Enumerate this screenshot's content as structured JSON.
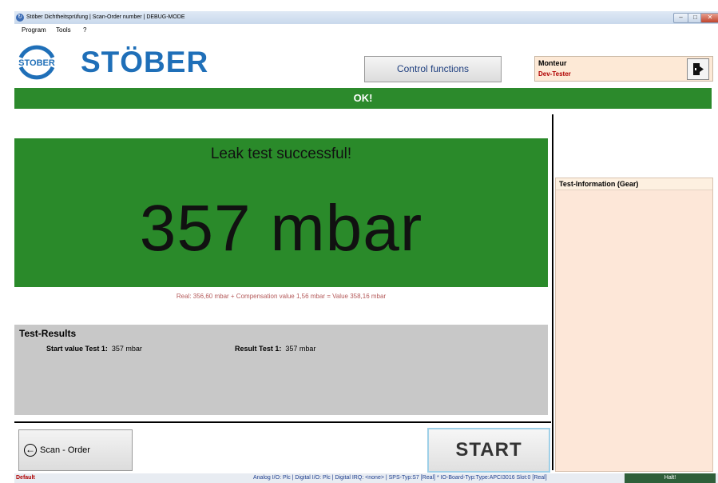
{
  "window": {
    "title": "Stöber Dichtheitsprüfung | Scan-Order number | DEBUG-MODE",
    "min_label": "–",
    "max_label": "□",
    "close_label": "✕"
  },
  "menu": {
    "items": [
      "Program",
      "Tools",
      "?"
    ]
  },
  "logo": {
    "text": "STÖBER",
    "badge_text": "STOBER"
  },
  "header": {
    "control_functions_label": "Control functions",
    "monteur_label": "Monteur",
    "monteur_value": "Dev-Tester"
  },
  "status_banner": {
    "text": "OK!",
    "color": "#2c8a2c"
  },
  "result": {
    "message": "Leak test successful!",
    "value": "357 mbar",
    "detail": "Real: 356,60 mbar + Compensation value 1,56 mbar = Value 358,16 mbar"
  },
  "test_results": {
    "title": "Test-Results",
    "start_label": "Start value Test 1:",
    "start_value": "357 mbar",
    "result_label": "Result Test 1:",
    "result_value": "357 mbar"
  },
  "buttons": {
    "scan_order": "Scan - Order",
    "start": "START"
  },
  "side_panel": {
    "title": "Test-Information (Gear)"
  },
  "statusbar": {
    "left": "Default",
    "middle": "Analog I/O: Plc  |  Digital I/O: Plc  |  Digital IRQ: <none>  |  SPS-Typ:S7 [Real] * IO-Board-Typ:Type:APCI3016 Slot:0 [Real]",
    "right": "Halt!"
  }
}
